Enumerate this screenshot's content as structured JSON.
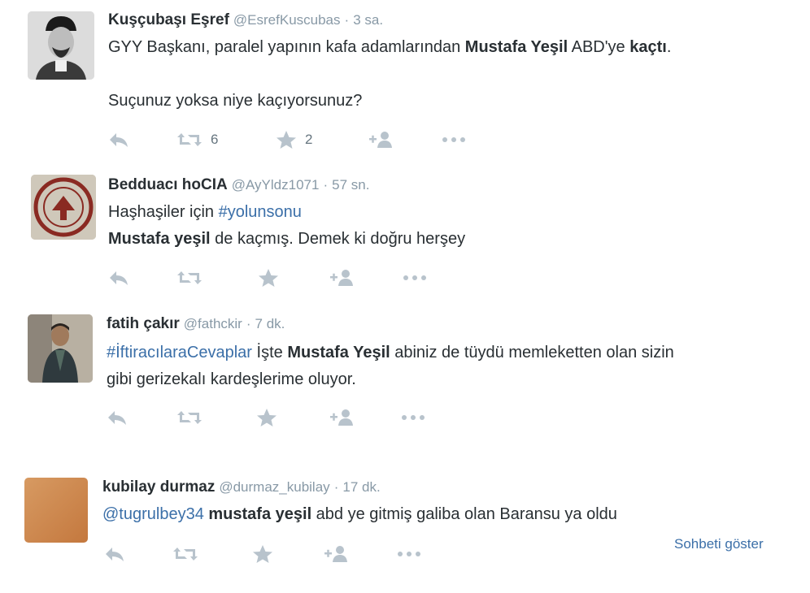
{
  "tweets": [
    {
      "name": "Kuşçubaşı Eşref",
      "handle": "@EsrefKuscubas",
      "sep": "·",
      "time": "3 sa.",
      "line1": [
        "GYY Başkanı, paralel yapının kafa adamlarından ",
        "Mustafa Yeşil",
        " ABD'ye ",
        "kaçtı",
        "."
      ],
      "line2": "Suçunuz yoksa niye kaçıyorsunuz?",
      "retweets": "6",
      "favorites": "2"
    },
    {
      "name": "Bedduacı hoCIA",
      "handle": "@AyYldz1071",
      "sep": "·",
      "time": "57 sn.",
      "line1": [
        "Haşhaşiler için ",
        "#yolunsonu"
      ],
      "line2": [
        "Mustafa yeşil",
        " de kaçmış. Demek ki doğru herşey"
      ]
    },
    {
      "name": "fatih çakır",
      "handle": "@fathckir",
      "sep": "·",
      "time": "7 dk.",
      "line1": [
        "#İftiracılaraCevaplar",
        " İşte ",
        "Mustafa Yeşil",
        " abiniz de tüydü memleketten olan sizin"
      ],
      "line2": "gibi gerizekalı kardeşlerime oluyor."
    },
    {
      "name": "kubilay durmaz",
      "handle": "@durmaz_kubilay",
      "sep": "·",
      "time": "17 dk.",
      "line1": [
        "@tugrulbey34",
        " ",
        "mustafa yeşil",
        " abd ye gitmiş galiba olan Baransu ya oldu"
      ],
      "conversation": "Sohbeti göster"
    }
  ],
  "colors": {
    "link": "#3b6fa8",
    "meta": "#8899a6",
    "icon": "#b8c3cc",
    "text": "#292f33"
  }
}
